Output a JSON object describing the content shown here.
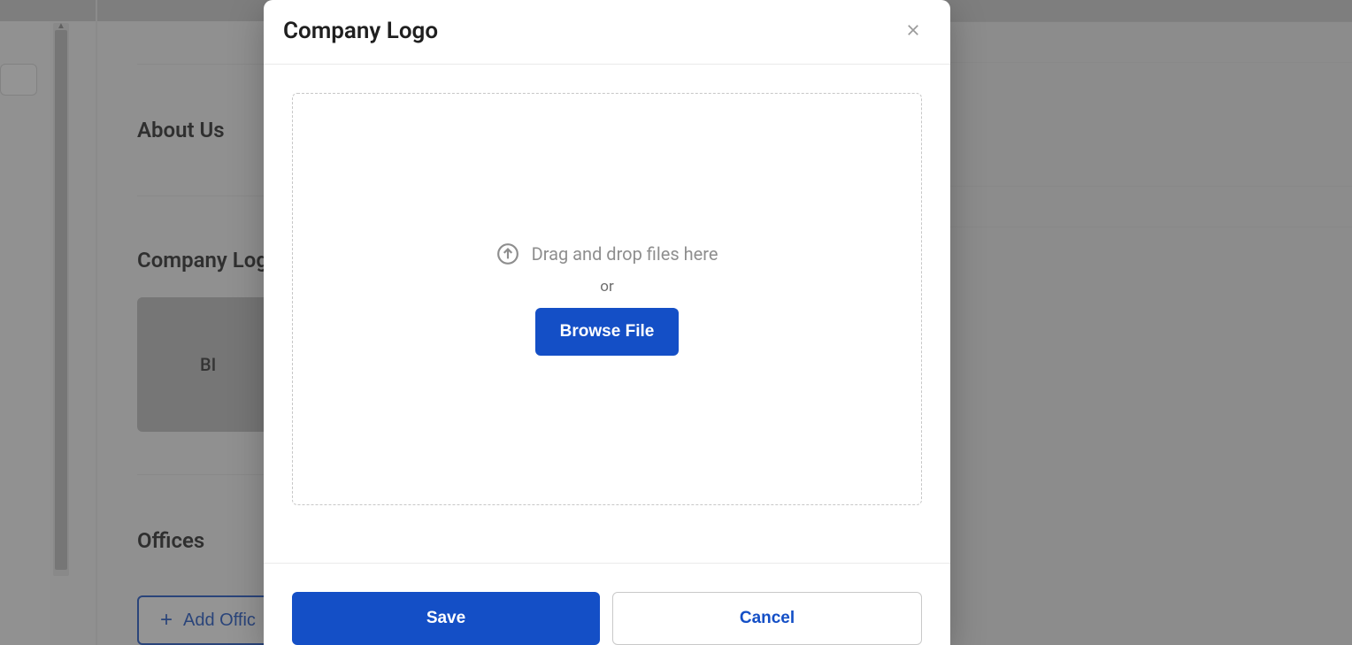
{
  "background": {
    "sections": {
      "about_us": "About Us",
      "company_logo": "Company Logo",
      "offices": "Offices"
    },
    "logo_placeholder_text": "BI",
    "add_office_label": "Add Offic"
  },
  "modal": {
    "title": "Company Logo",
    "close_icon": "close-icon",
    "dropzone": {
      "upload_icon": "upload-arrow-icon",
      "drag_text": "Drag and drop files here",
      "or_text": "or",
      "browse_label": "Browse File"
    },
    "footer": {
      "save_label": "Save",
      "cancel_label": "Cancel"
    }
  }
}
